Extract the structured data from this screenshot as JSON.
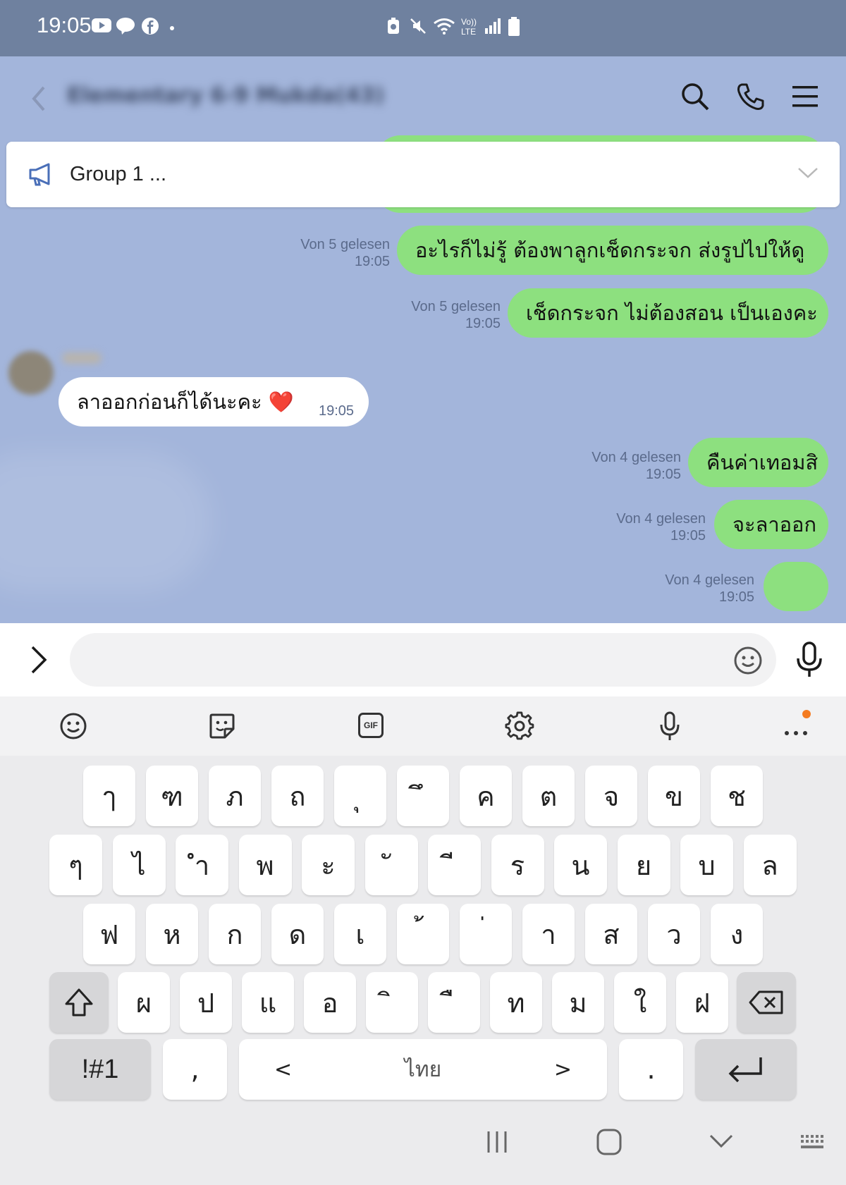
{
  "status_bar": {
    "time": "19:05"
  },
  "chat": {
    "title": "Elementary 6-9 Mukda(43)",
    "pinned_announcement": "Group 1 ...",
    "messages": [
      {
        "from": "me",
        "text": "อะไรก็ไม่รู้ ต้องพาลูกเช็ดกระจก ส่งรูปไปให้ดู",
        "read": "Von 5 gelesen",
        "time": "19:05"
      },
      {
        "from": "me",
        "text": "เช็ดกระจก ไม่ต้องสอน เป็นเองคะ",
        "read": "Von 5 gelesen",
        "time": "19:05"
      },
      {
        "from": "other",
        "text": "ลาออกก่อนก็ได้นะคะ ❤️",
        "time": "19:05"
      },
      {
        "from": "me",
        "text": "คืนค่าเทอมสิ",
        "read": "Von 4 gelesen",
        "time": "19:05"
      },
      {
        "from": "me",
        "text": "จะลาออก",
        "read": "Von 4 gelesen",
        "time": "19:05"
      },
      {
        "from": "me",
        "text": "",
        "read": "Von 4 gelesen",
        "time": "19:05"
      }
    ]
  },
  "input": {
    "placeholder": ""
  },
  "keyboard": {
    "row1": [
      "ๅ",
      "ฑ",
      "ภ",
      "ถ",
      "ุ",
      "ึ",
      "ค",
      "ต",
      "จ",
      "ข",
      "ช"
    ],
    "row2": [
      "ๆ",
      "ไ",
      "ำ",
      "พ",
      "ะ",
      "ั",
      "ี",
      "ร",
      "น",
      "ย",
      "บ",
      "ล"
    ],
    "row3": [
      "ฟ",
      "ห",
      "ก",
      "ด",
      "เ",
      "้",
      "่",
      "า",
      "ส",
      "ว",
      "ง"
    ],
    "row4": [
      "ผ",
      "ป",
      "แ",
      "อ",
      "ิ",
      "ื",
      "ท",
      "ม",
      "ใ",
      "ฝ"
    ],
    "symbols_label": "!#1",
    "comma": ",",
    "space_label": "ไทย",
    "space_left": "<",
    "space_right": ">",
    "period": ".",
    "toolbar_gif": "GIF"
  },
  "colors": {
    "status_bar": "#6f819f",
    "chat_bg": "#a3b5db",
    "bubble_green": "#8de07f",
    "bubble_white": "#ffffff",
    "notification_dot": "#f47b20"
  }
}
